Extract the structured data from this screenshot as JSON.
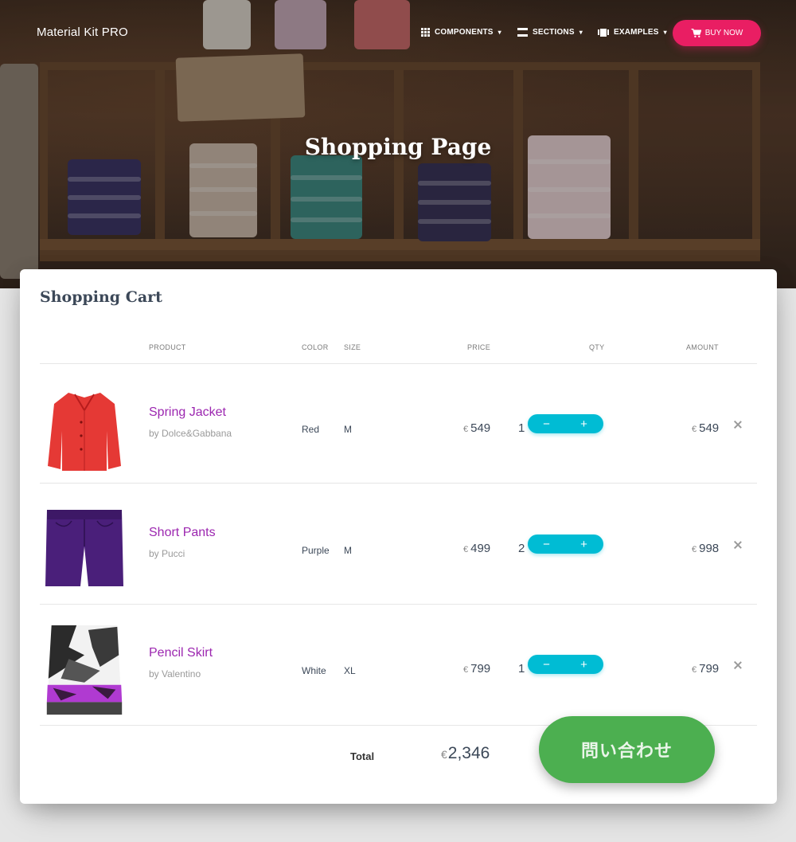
{
  "navbar": {
    "brand": "Material Kit PRO",
    "items": [
      {
        "label": "COMPONENTS",
        "icon": "apps-grid-icon"
      },
      {
        "label": "SECTIONS",
        "icon": "view-day-icon"
      },
      {
        "label": "EXAMPLES",
        "icon": "view-carousel-icon"
      }
    ],
    "buy_button": {
      "label": "BUY NOW",
      "icon": "shopping-cart-icon",
      "color": "#e91e63"
    }
  },
  "hero": {
    "title": "Shopping Page"
  },
  "cart": {
    "title": "Shopping Cart",
    "columns": {
      "product": "PRODUCT",
      "color": "COLOR",
      "size": "SIZE",
      "price": "PRICE",
      "qty": "QTY",
      "amount": "AMOUNT"
    },
    "currency": "€",
    "rows": [
      {
        "name": "Spring Jacket",
        "brand": "by Dolce&Gabbana",
        "color": "Red",
        "size": "M",
        "price": "549",
        "qty": "1",
        "amount": "549"
      },
      {
        "name": "Short Pants",
        "brand": "by Pucci",
        "color": "Purple",
        "size": "M",
        "price": "499",
        "qty": "2",
        "amount": "998"
      },
      {
        "name": "Pencil Skirt",
        "brand": "by Valentino",
        "color": "White",
        "size": "XL",
        "price": "799",
        "qty": "1",
        "amount": "799"
      }
    ],
    "qty_minus": "−",
    "qty_plus": "+",
    "total_label": "Total",
    "total_value": "2,346"
  },
  "contact_button": {
    "label": "問い合わせ",
    "color": "#4caf50"
  },
  "colors": {
    "accent_purple": "#9c27b0",
    "info_cyan": "#00bcd4",
    "rose": "#e91e63"
  }
}
